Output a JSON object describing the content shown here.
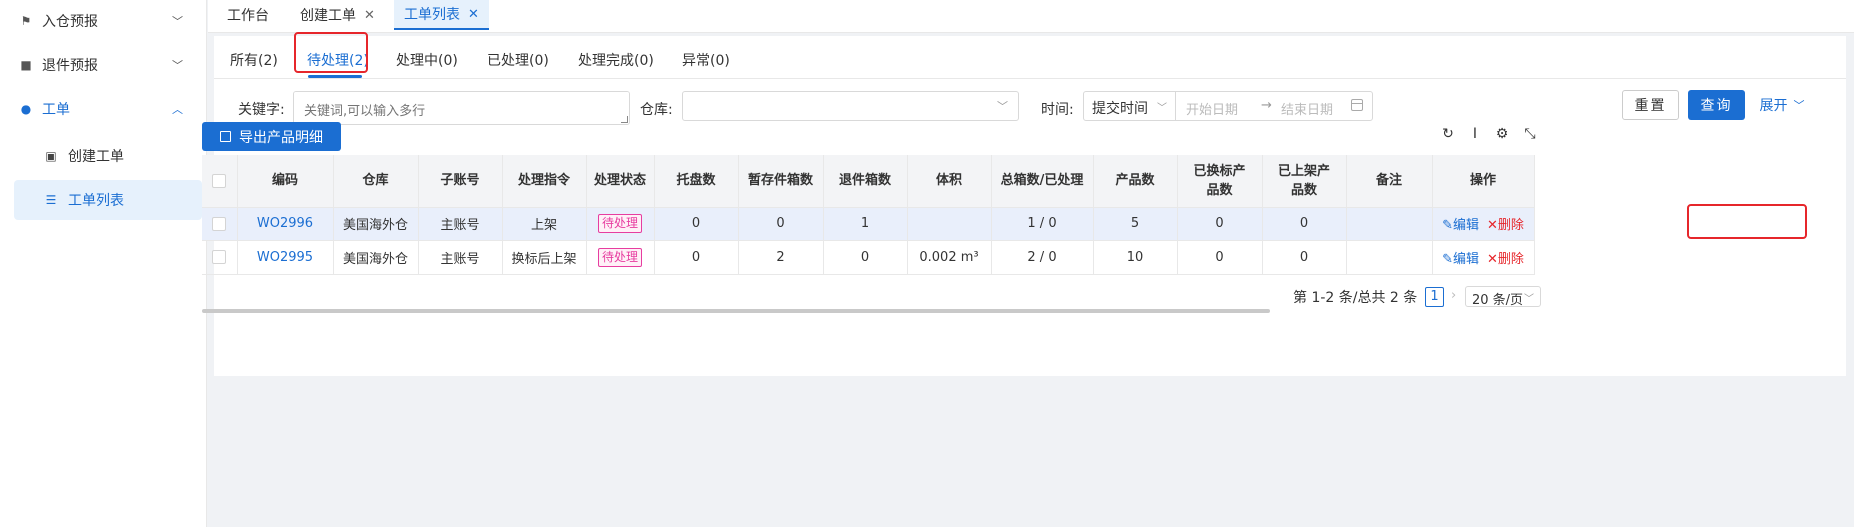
{
  "sidebar": {
    "items": [
      {
        "label": "入仓预报",
        "icon": "flag-icon"
      },
      {
        "label": "退件预报",
        "icon": "bag-icon"
      },
      {
        "label": "工单",
        "icon": "user-icon"
      }
    ],
    "sub_items": [
      {
        "label": "创建工单",
        "icon": "document-icon"
      },
      {
        "label": "工单列表",
        "icon": "list-icon"
      }
    ]
  },
  "top_tabs": [
    {
      "label": "工作台"
    },
    {
      "label": "创建工单",
      "close": "✕"
    },
    {
      "label": "工单列表",
      "close": "✕"
    }
  ],
  "status_tabs": [
    "所有(2)",
    "待处理(2)",
    "处理中(0)",
    "已处理(0)",
    "处理完成(0)",
    "异常(0)"
  ],
  "filters": {
    "keyword_label": "关键字:",
    "keyword_placeholder": "关键词,可以输入多行",
    "warehouse_label": "仓库:",
    "time_label": "时间:",
    "time_type": "提交时间",
    "start_placeholder": "开始日期",
    "end_placeholder": "结束日期",
    "reset": "重置",
    "query": "查询",
    "expand": "展开"
  },
  "export_button": "导出产品明细",
  "toolbar_icons": [
    "refresh-icon",
    "column-height-icon",
    "settings-icon",
    "fullscreen-icon"
  ],
  "table": {
    "headers": [
      "编码",
      "仓库",
      "子账号",
      "处理指令",
      "处理状态",
      "托盘数",
      "暂存件箱数",
      "退件箱数",
      "体积",
      "总箱数/已处理",
      "产品数",
      "已换标产品数",
      "已上架产品数",
      "备注",
      "操作"
    ],
    "rows": [
      {
        "code": "WO2996",
        "warehouse": "美国海外仓",
        "sub_account": "主账号",
        "instruction": "上架",
        "status": "待处理",
        "pallets": "0",
        "staged_boxes": "0",
        "return_boxes": "1",
        "volume": "",
        "total_processed": "1 / 0",
        "products": "5",
        "relabeled": "0",
        "shelved": "0",
        "remark": "",
        "edit": "编辑",
        "delete": "删除"
      },
      {
        "code": "WO2995",
        "warehouse": "美国海外仓",
        "sub_account": "主账号",
        "instruction": "换标后上架",
        "status": "待处理",
        "pallets": "0",
        "staged_boxes": "2",
        "return_boxes": "0",
        "volume": "0.002 m³",
        "total_processed": "2 / 0",
        "products": "10",
        "relabeled": "0",
        "shelved": "0",
        "remark": "",
        "edit": "编辑",
        "delete": "删除"
      }
    ]
  },
  "pagination": {
    "summary": "第 1-2 条/总共 2 条",
    "current": "1",
    "page_size": "20 条/页"
  },
  "colors": {
    "accent": "#1b6ed2",
    "danger": "#e6262b",
    "badge": "#e73da0"
  }
}
